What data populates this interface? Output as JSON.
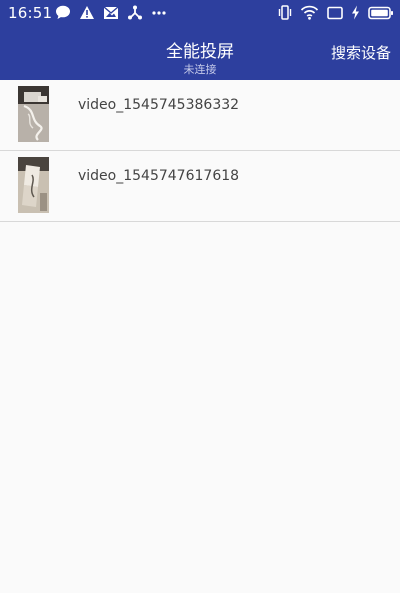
{
  "status_bar": {
    "time": "16:51",
    "left_icons": [
      "chat-bubble-icon",
      "warning-icon",
      "mail-icon",
      "share-hub-icon",
      "more-icon"
    ],
    "right_icons": [
      "vibrate-icon",
      "wifi-icon",
      "cast-icon",
      "charging-icon",
      "battery-icon"
    ]
  },
  "app_bar": {
    "title": "全能投屏",
    "subtitle": "未连接",
    "action_label": "搜索设备"
  },
  "videos": [
    {
      "name": "video_1545745386332"
    },
    {
      "name": "video_1545747617618"
    }
  ],
  "colors": {
    "app_bar_bg": "#2d3f9e",
    "page_bg": "#fafafa",
    "divider": "#d8d8d8",
    "item_text": "#444444"
  }
}
